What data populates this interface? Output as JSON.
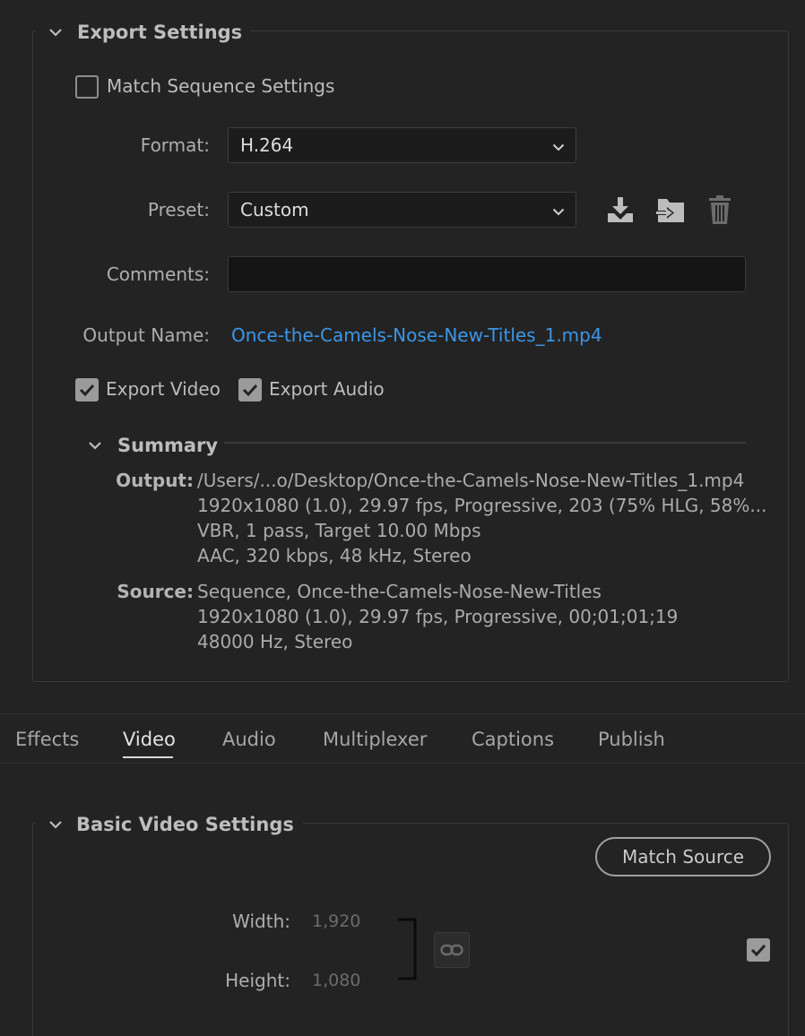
{
  "export_settings": {
    "title": "Export Settings",
    "match_sequence_label": "Match Sequence Settings",
    "match_sequence_checked": false,
    "format_label": "Format:",
    "format_value": "H.264",
    "preset_label": "Preset:",
    "preset_value": "Custom",
    "comments_label": "Comments:",
    "comments_value": "",
    "output_name_label": "Output Name:",
    "output_name_value": "Once-the-Camels-Nose-New-Titles_1.mp4",
    "export_video_label": "Export Video",
    "export_video_checked": true,
    "export_audio_label": "Export Audio",
    "export_audio_checked": true,
    "icons": {
      "save_preset": "save-preset-icon",
      "import_preset": "import-preset-icon",
      "delete_preset": "trash-icon"
    }
  },
  "summary": {
    "title": "Summary",
    "output_key": "Output:",
    "output_lines": [
      "/Users/...o/Desktop/Once-the-Camels-Nose-New-Titles_1.mp4",
      "1920x1080 (1.0), 29.97 fps, Progressive, 203 (75% HLG, 58%...",
      "VBR, 1 pass, Target 10.00 Mbps",
      "AAC, 320 kbps, 48 kHz, Stereo"
    ],
    "source_key": "Source:",
    "source_lines": [
      "Sequence, Once-the-Camels-Nose-New-Titles",
      "1920x1080 (1.0), 29.97 fps, Progressive, 00;01;01;19",
      "48000 Hz, Stereo"
    ]
  },
  "tabs": {
    "items": [
      "Effects",
      "Video",
      "Audio",
      "Multiplexer",
      "Captions",
      "Publish"
    ],
    "active": "Video"
  },
  "basic_video": {
    "title": "Basic Video Settings",
    "match_source_label": "Match Source",
    "width_label": "Width:",
    "width_value": "1,920",
    "height_label": "Height:",
    "height_value": "1,080",
    "checkbox_checked": true
  },
  "colors": {
    "background": "#232323",
    "link": "#3d96e6",
    "field": "#1c1c1c"
  }
}
